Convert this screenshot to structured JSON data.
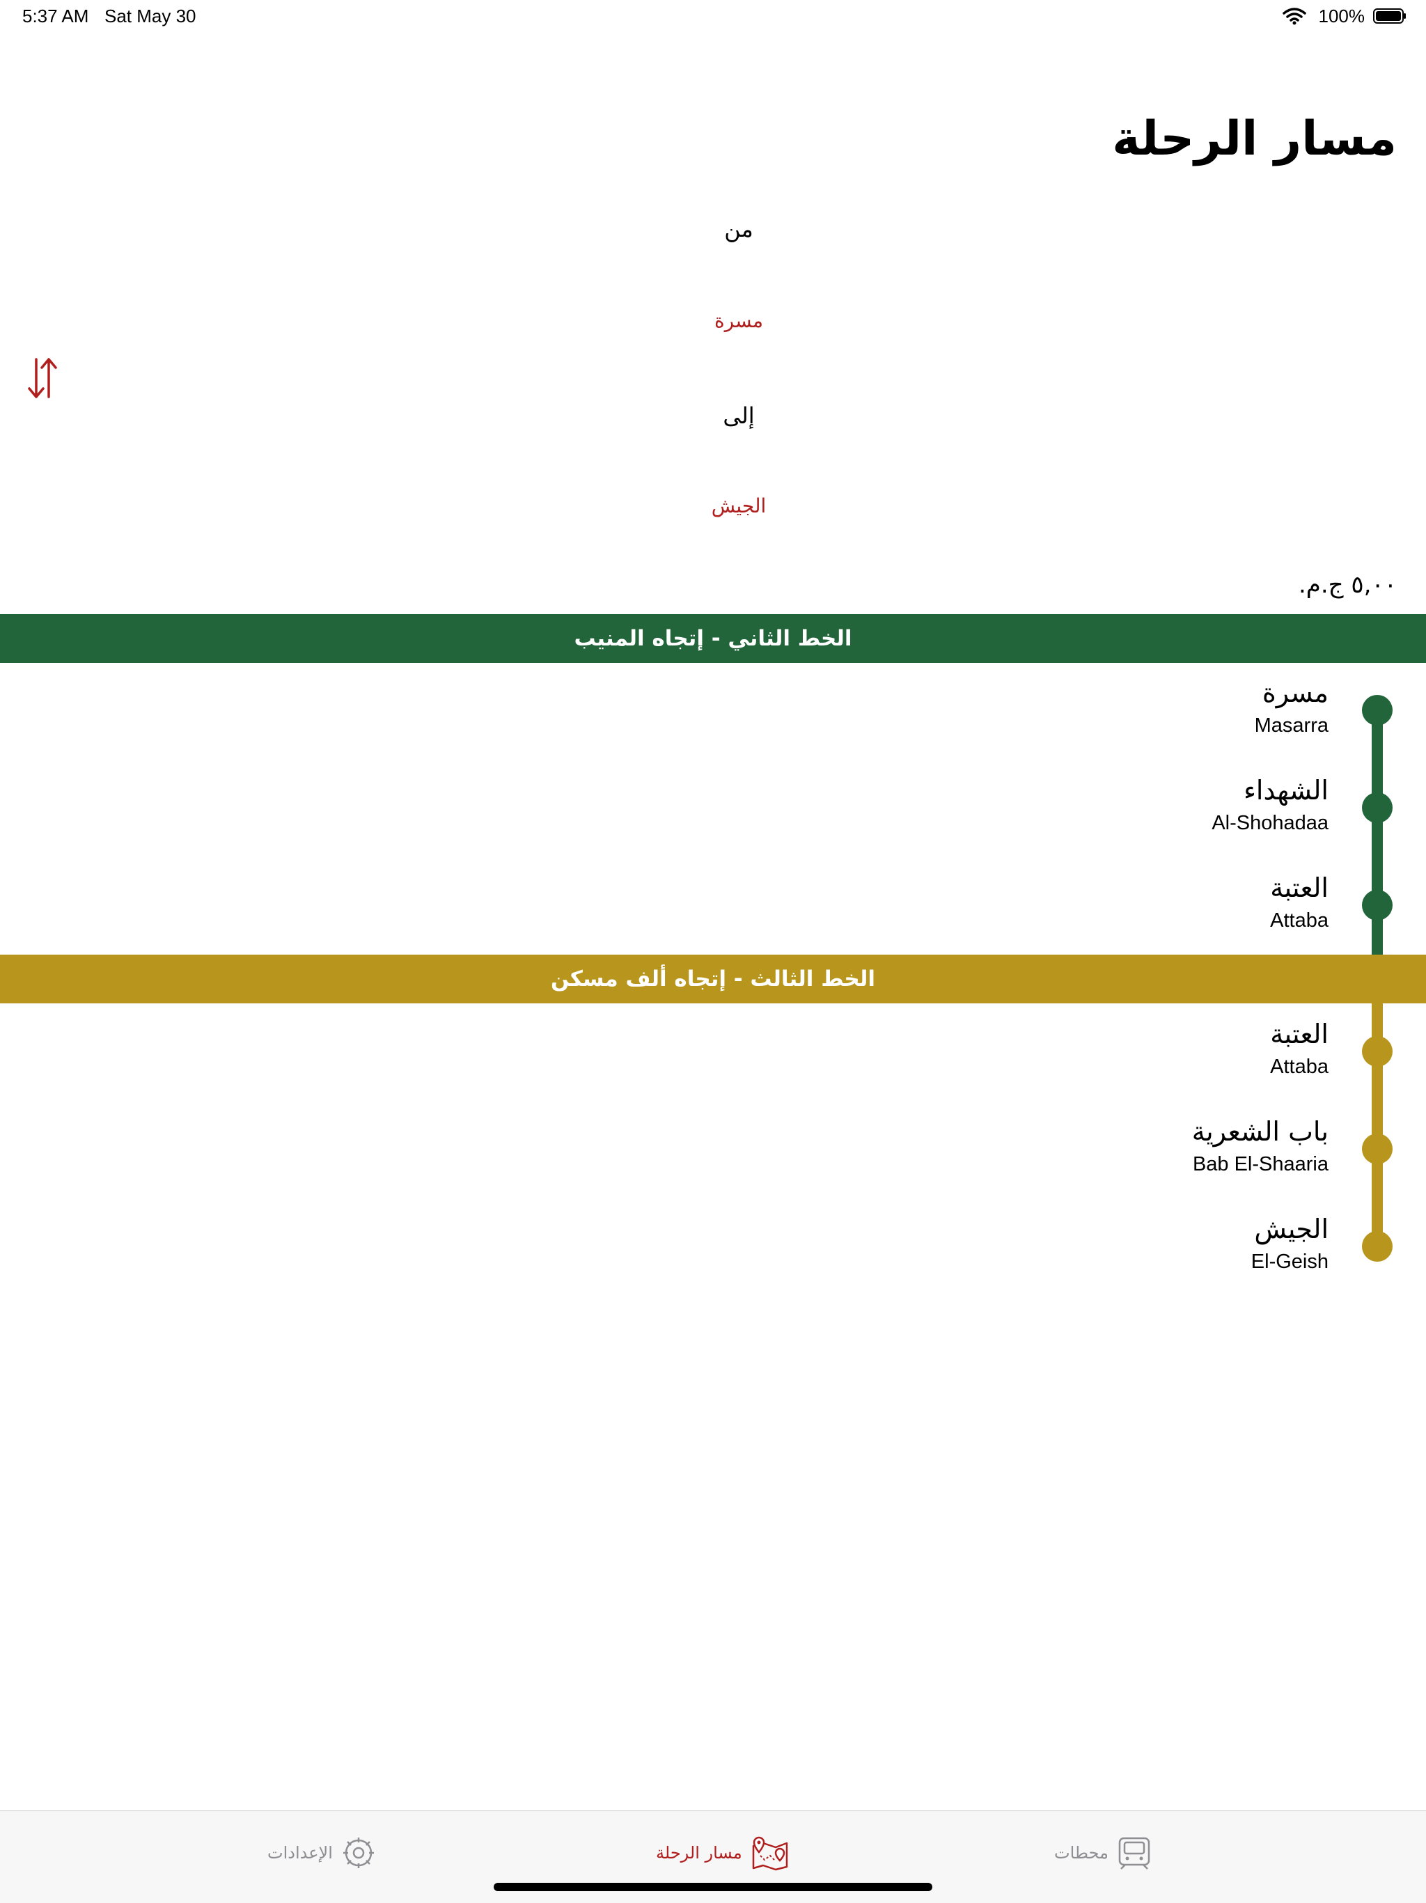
{
  "status_bar": {
    "time": "5:37 AM",
    "date": "Sat May 30",
    "battery": "100%"
  },
  "page": {
    "title": "مسار الرحلة"
  },
  "trip": {
    "from_label": "من",
    "from_value": "مسرة",
    "to_label": "إلى",
    "to_value": "الجيش",
    "fare": "٥,٠٠ ج.م."
  },
  "segments": [
    {
      "header": "الخط الثاني - إتجاه المنيب",
      "color": "#22653a",
      "stations": [
        {
          "ar": "مسرة",
          "en": "Masarra"
        },
        {
          "ar": "الشهداء",
          "en": "Al-Shohadaa"
        },
        {
          "ar": "العتبة",
          "en": "Attaba"
        }
      ]
    },
    {
      "header": "الخط الثالث - إتجاه ألف مسكن",
      "color": "#b8961d",
      "stations": [
        {
          "ar": "العتبة",
          "en": "Attaba"
        },
        {
          "ar": "باب الشعرية",
          "en": "Bab El-Shaaria"
        },
        {
          "ar": "الجيش",
          "en": "El-Geish"
        }
      ]
    }
  ],
  "tabbar": {
    "tabs": [
      {
        "label": "الإعدادات",
        "icon": "settings-icon",
        "active": false
      },
      {
        "label": "مسار الرحلة",
        "icon": "route-map-icon",
        "active": true
      },
      {
        "label": "محطات",
        "icon": "train-icon",
        "active": false
      }
    ]
  },
  "colors": {
    "accent": "#b01e1e",
    "line2": "#22653a",
    "line3": "#b8961d"
  }
}
